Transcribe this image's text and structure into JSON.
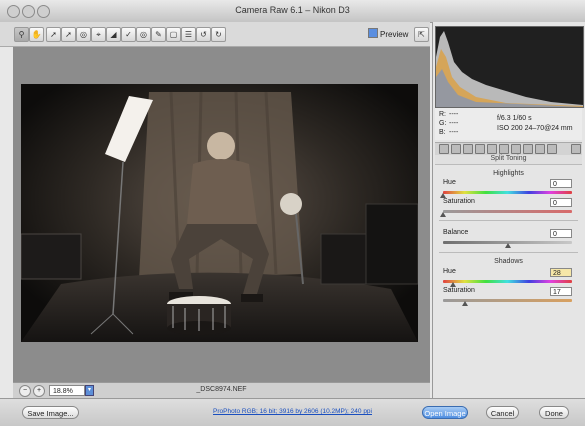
{
  "window": {
    "title": "Camera Raw 6.1  –  Nikon D3"
  },
  "toolbar": {
    "tools": [
      "zoom-icon",
      "hand-icon",
      "white-balance-icon",
      "color-sampler-icon",
      "targeted-adjust-icon",
      "crop-icon",
      "straighten-icon",
      "spot-removal-icon",
      "red-eye-icon",
      "adjustment-brush-icon",
      "graduated-filter-icon",
      "preferences-icon",
      "rotate-ccw-icon",
      "rotate-cw-icon"
    ],
    "preview_label": "Preview",
    "fullscreen_icon": "fullscreen-icon"
  },
  "readout": {
    "r_label": "R:",
    "g_label": "G:",
    "b_label": "B:",
    "r_value": "----",
    "g_value": "----",
    "b_value": "----",
    "aperture_shutter": "f/6.3  1/60 s",
    "iso_lens": "ISO 200  24–70@24 mm"
  },
  "panel": {
    "title": "Split Toning",
    "highlights": {
      "title": "Highlights",
      "hue_label": "Hue",
      "hue_value": "0",
      "hue_level": 0,
      "saturation_label": "Saturation",
      "saturation_value": "0",
      "saturation_level": 0
    },
    "balance": {
      "label": "Balance",
      "value": "0",
      "level": 0.5
    },
    "shadows": {
      "title": "Shadows",
      "hue_label": "Hue",
      "hue_value": "28",
      "hue_level": 0.078,
      "saturation_label": "Saturation",
      "saturation_value": "17",
      "saturation_level": 0.17
    }
  },
  "status": {
    "zoom": "18.8%",
    "filename": "_DSC8974.NEF"
  },
  "bottom": {
    "save_label": "Save Image...",
    "workflow_link": "ProPhoto RGB; 16 bit; 3916 by 2606 (10.2MP); 240 ppi",
    "open_label": "Open Image",
    "cancel_label": "Cancel",
    "done_label": "Done"
  },
  "colors": {
    "accent": "#4f8ee0",
    "highlighted_value": "#f6e7a8"
  }
}
